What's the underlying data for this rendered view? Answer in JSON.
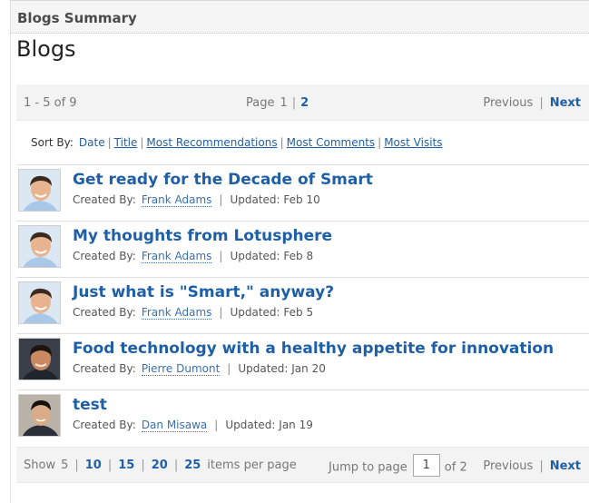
{
  "header": {
    "title": "Blogs Summary"
  },
  "page_heading": "Blogs",
  "paging_top": {
    "count": "1 - 5 of 9",
    "page_label": "Page",
    "current_page": "1",
    "other_page": "2",
    "previous": "Previous",
    "next": "Next"
  },
  "sort": {
    "label": "Sort By:",
    "options": [
      "Date",
      "Title",
      "Most Recommendations",
      "Most Comments",
      "Most Visits"
    ]
  },
  "entries": [
    {
      "title": "Get ready for the Decade of Smart",
      "created_label": "Created By:",
      "author": "Frank Adams",
      "updated": "Updated: Feb 10",
      "avatar": "frank-adams-avatar"
    },
    {
      "title": "My thoughts from Lotusphere",
      "created_label": "Created By:",
      "author": "Frank Adams",
      "updated": "Updated: Feb 8",
      "avatar": "frank-adams-avatar"
    },
    {
      "title": "Just what is \"Smart,\" anyway?",
      "created_label": "Created By:",
      "author": "Frank Adams",
      "updated": "Updated: Feb 5",
      "avatar": "frank-adams-avatar"
    },
    {
      "title": "Food technology with a healthy appetite for innovation",
      "created_label": "Created By:",
      "author": "Pierre Dumont",
      "updated": "Updated: Jan 20",
      "avatar": "pierre-dumont-avatar"
    },
    {
      "title": "test",
      "created_label": "Created By:",
      "author": "Dan Misawa",
      "updated": "Updated: Jan 19",
      "avatar": "dan-misawa-avatar"
    }
  ],
  "paging_bottom": {
    "show_label": "Show",
    "current_size": "5",
    "sizes": [
      "10",
      "15",
      "20",
      "25"
    ],
    "items_label": "items per page",
    "jump_label": "Jump to page",
    "jump_value": "1",
    "of_label": "of 2",
    "previous": "Previous",
    "next": "Next"
  },
  "colors": {
    "link": "#1f5fa8",
    "bar_bg": "#f3f3f3"
  }
}
